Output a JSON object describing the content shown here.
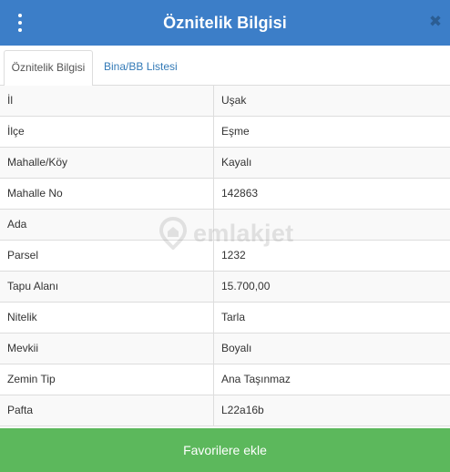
{
  "header": {
    "title": "Öznitelik Bilgisi",
    "menu_icon": "vertical-ellipsis-icon",
    "close_icon": "close-icon",
    "close_glyph": "✖"
  },
  "tabs": [
    {
      "label": "Öznitelik Bilgisi",
      "active": true
    },
    {
      "label": "Bina/BB Listesi",
      "active": false
    }
  ],
  "attributes": [
    {
      "label": "İl",
      "value": "Uşak"
    },
    {
      "label": "İlçe",
      "value": "Eşme"
    },
    {
      "label": "Mahalle/Köy",
      "value": "Kayalı"
    },
    {
      "label": "Mahalle No",
      "value": "142863"
    },
    {
      "label": "Ada",
      "value": ""
    },
    {
      "label": "Parsel",
      "value": "1232"
    },
    {
      "label": "Tapu Alanı",
      "value": "15.700,00"
    },
    {
      "label": "Nitelik",
      "value": "Tarla"
    },
    {
      "label": "Mevkii",
      "value": "Boyalı"
    },
    {
      "label": "Zemin Tip",
      "value": "Ana Taşınmaz"
    },
    {
      "label": "Pafta",
      "value": "L22a16b"
    }
  ],
  "watermark": {
    "text": "emlakjet",
    "icon": "map-pin-icon"
  },
  "footer": {
    "button_label": "Favorilere ekle"
  },
  "colors": {
    "header_bg": "#3c7ec8",
    "tab_link": "#337ab7",
    "button_bg": "#5cb85c"
  }
}
